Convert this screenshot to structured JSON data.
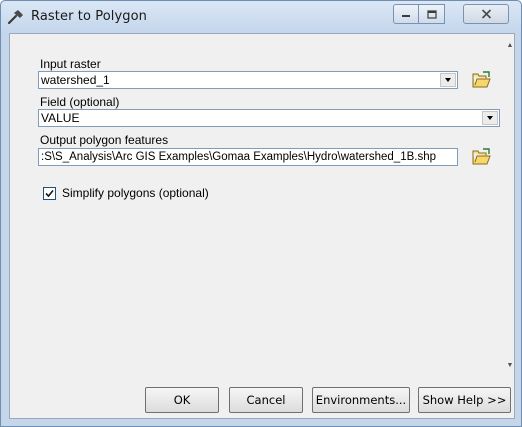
{
  "window": {
    "title": "Raster to Polygon",
    "icon": "hammer-icon"
  },
  "form": {
    "input_raster": {
      "label": "Input raster",
      "value": "watershed_1"
    },
    "field": {
      "label": "Field (optional)",
      "value": "VALUE"
    },
    "output_polygon": {
      "label": "Output polygon features",
      "value": ":S\\S_Analysis\\Arc GIS Examples\\Gomaa Examples\\Hydro\\watershed_1B.shp"
    },
    "simplify": {
      "label": "Simplify polygons (optional)",
      "checked": true
    }
  },
  "buttons": {
    "ok": "OK",
    "cancel": "Cancel",
    "environments": "Environments...",
    "show_help": "Show Help >>"
  },
  "colors": {
    "frame": "#c5d6ea",
    "client": "#f0f0f0",
    "input_border": "#7f9db9"
  }
}
